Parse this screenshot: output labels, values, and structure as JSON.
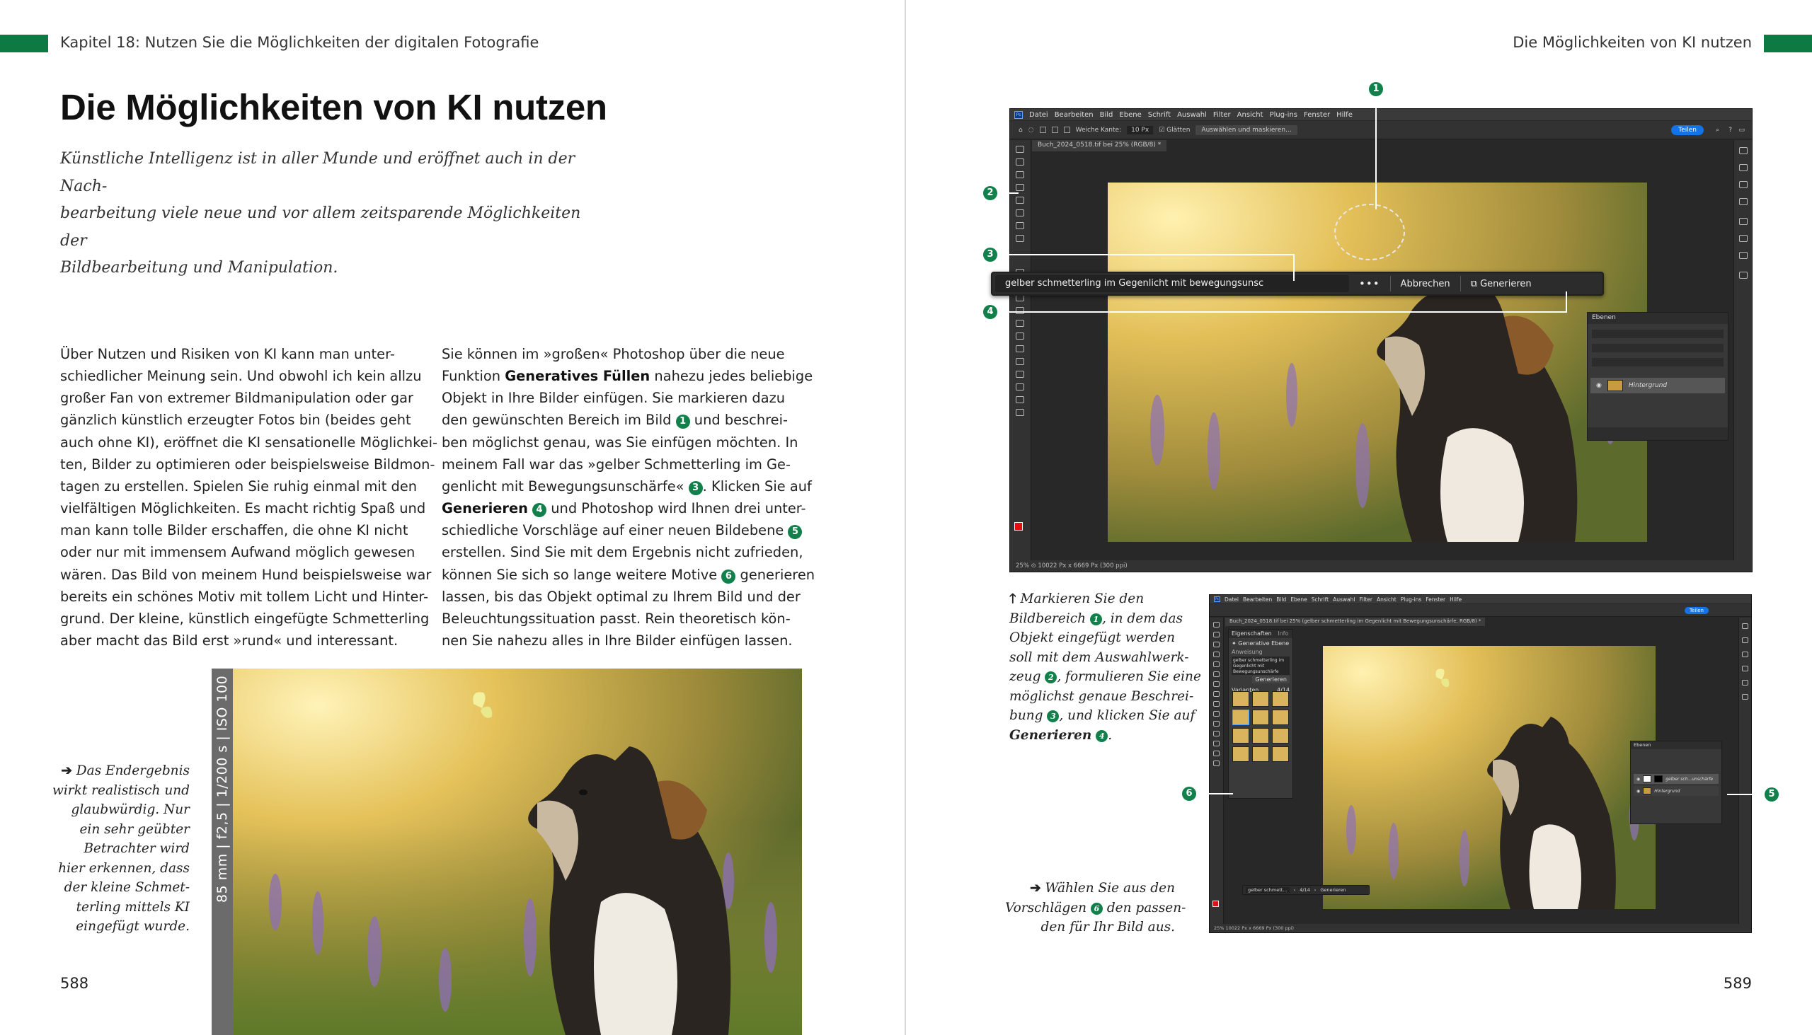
{
  "left_page": {
    "chapter_header": "Kapitel 18:  Nutzen Sie die Möglichkeiten der digitalen Fotografie",
    "title": "Die Möglichkeiten von KI nutzen",
    "intro_lines": [
      "Künstliche Intelligenz ist in aller Munde und eröffnet auch in der Nach-",
      "bearbeitung viele neue und vor allem zeitsparende Möglichkeiten der",
      "Bildbearbeitung und Manipulation."
    ],
    "col1_lines": [
      "Über Nutzen und Risiken von KI kann man unter-",
      "schiedlicher Meinung sein. Und obwohl ich kein allzu",
      "großer Fan von extremer Bildmanipulation oder gar",
      "gänzlich künstlich erzeugter Fotos bin (beides geht",
      "auch ohne KI), eröffnet die KI sensationelle Möglichkei-",
      "ten, Bilder zu optimieren oder beispielsweise Bildmon-",
      "tagen zu erstellen. Spielen Sie ruhig einmal mit den",
      "vielfältigen Möglichkeiten. Es macht richtig Spaß und",
      "man kann tolle Bilder erschaffen, die ohne KI nicht",
      "oder nur mit immensem Aufwand möglich gewesen",
      "wären. Das Bild von meinem Hund beispielsweise war",
      "bereits ein schönes Motiv mit tollem Licht und Hinter-",
      "grund. Der kleine, künstlich eingefügte Schmetterling",
      "aber macht das Bild erst »rund« und interessant."
    ],
    "col2": {
      "l1": "Sie können im »großen« Photoshop über die neue",
      "l2_pre": "Funktion ",
      "l2_em": "Generatives Füllen",
      "l2_post": " nahezu jedes beliebige",
      "l3": "Objekt in Ihre Bilder einfügen. Sie markieren dazu",
      "l4_pre": "den gewünschten Bereich im Bild ",
      "l4_post": " und beschrei-",
      "l5": "ben möglichst genau, was Sie einfügen möchten. In",
      "l6": "meinem Fall war das »gelber Schmetterling im Ge-",
      "l7_pre": "genlicht mit Bewegungsunschärfe« ",
      "l7_post": ". Klicken Sie auf",
      "l8_em": "Generieren",
      "l8_post": " und Photoshop wird Ihnen drei unter-",
      "l9_pre": "schiedliche Vorschläge auf einer neuen Bildebene ",
      "l10": "erstellen. Sind Sie mit dem Ergebnis nicht zufrieden,",
      "l11_pre": "können Sie sich so lange weitere Motive ",
      "l11_post": " generieren",
      "l12": "lassen, bis das Objekt optimal zu Ihrem Bild und der",
      "l13": "Beleuchtungssituation passt. Rein theoretisch kön-",
      "l14": "nen Sie nahezu alles in Ihre Bilder einfügen lassen."
    },
    "photo_exif": "85 mm | f2,5 | 1/200 s | ISO 100",
    "caption_lines": [
      "Das Endergebnis",
      "wirkt realistisch und",
      "glaubwürdig. Nur",
      "ein sehr geübter",
      "Betrachter wird",
      "hier erkennen, dass",
      "der kleine Schmet-",
      "terling mittels KI",
      "eingefügt wurde."
    ],
    "page_number": "588"
  },
  "right_page": {
    "running_header": "Die Möglichkeiten von KI nutzen",
    "page_number": "589",
    "callout_numbers": [
      "1",
      "2",
      "3",
      "4",
      "5",
      "6"
    ],
    "caption_top": {
      "l1": "Markieren Sie den",
      "l2_pre": "Bildbereich ",
      "l2_post": ", in dem das",
      "l3": "Objekt eingefügt werden",
      "l4": "soll mit dem Auswahlwerk-",
      "l5_pre": "zeug ",
      "l5_post": ", formulieren Sie eine",
      "l6": "möglichst genaue Beschrei-",
      "l7_pre": "bung ",
      "l7_post": ", und klicken Sie auf",
      "l8_em": "Generieren",
      "l8_post": "."
    },
    "caption_bottom": {
      "l1": "Wählen Sie aus den",
      "l2_pre": "Vorschlägen ",
      "l2_post": " den passen-",
      "l3": "den für Ihr Bild aus."
    }
  },
  "photoshop_top": {
    "menu_items": [
      "Datei",
      "Bearbeiten",
      "Bild",
      "Ebene",
      "Schrift",
      "Auswahl",
      "Filter",
      "Ansicht",
      "Plug-ins",
      "Fenster",
      "Hilfe"
    ],
    "options": [
      "Weiche Kante:",
      "10 Px",
      "Glätten",
      "Auswählen und maskieren..."
    ],
    "share_button": "Teilen",
    "doc_tab": "Buch_2024_0518.tif bei 25% (RGB/8) *",
    "prompt_text": "gelber schmetterling im Gegenlicht mit bewegungsunsc",
    "cancel_label": "Abbrechen",
    "generate_label": "Generieren",
    "layers_title": "Ebenen",
    "layer_name": "Hintergrund",
    "status": "25%    ⊙ 10022 Px x 6669 Px (300 ppi)"
  },
  "photoshop_bottom": {
    "menu_items": [
      "Datei",
      "Bearbeiten",
      "Bild",
      "Ebene",
      "Schrift",
      "Auswahl",
      "Filter",
      "Ansicht",
      "Plug-ins",
      "Fenster",
      "Hilfe"
    ],
    "share_button": "Teilen",
    "doc_tab": "Buch_2024_0518.tif bei 25% (gelber schmetterling im Gegenlicht mit Bewegungsunschärfe, RGB/8) *",
    "props_tab": "Eigenschaften",
    "info_tab": "Info",
    "gen_layer": "Generative Ebene",
    "prompt_label": "Anweisung",
    "prompt_text": "gelber schmetterling im Gegenlicht mit Bewegungsunschärfe",
    "generate_label": "Generieren",
    "variants_label": "Varianten",
    "variant_count": "4/14",
    "bar_text": "gelber schmett...",
    "bar_count": "4/14",
    "bar_generate": "Generieren",
    "layers_title": "Ebenen",
    "layer_gen": "gelber sch...unschärfe",
    "layer_bg": "Hintergrund",
    "status": "25%    10022 Px x 6669 Px (300 ppi)"
  }
}
